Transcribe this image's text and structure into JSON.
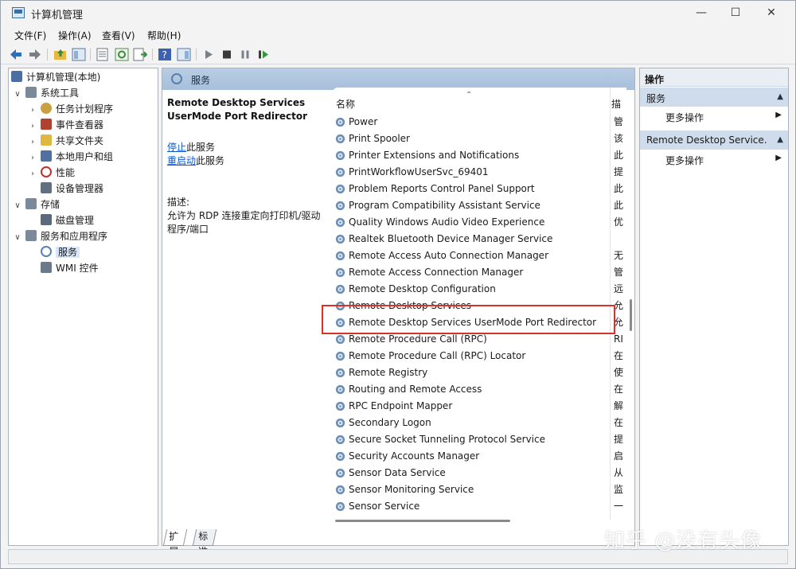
{
  "window": {
    "title": "计算机管理"
  },
  "window_controls": {
    "minimize": "—",
    "maximize": "☐",
    "close": "✕"
  },
  "menu": [
    "文件(F)",
    "操作(A)",
    "查看(V)",
    "帮助(H)"
  ],
  "tree": {
    "items": [
      {
        "label": "计算机管理(本地)",
        "expander": "",
        "icon_color": "#4a6fa5"
      },
      {
        "label": "系统工具",
        "expander": "∨",
        "icon_color": "#7a8a9a"
      },
      {
        "label": "任务计划程序",
        "expander": "›",
        "icon_color": "#c8a040"
      },
      {
        "label": "事件查看器",
        "expander": "›",
        "icon_color": "#b04030"
      },
      {
        "label": "共享文件夹",
        "expander": "›",
        "icon_color": "#e0b840"
      },
      {
        "label": "本地用户和组",
        "expander": "›",
        "icon_color": "#5070a0"
      },
      {
        "label": "性能",
        "expander": "›",
        "icon_color": "#c03030"
      },
      {
        "label": "设备管理器",
        "expander": "",
        "icon_color": "#607080"
      },
      {
        "label": "存储",
        "expander": "∨",
        "icon_color": "#7a8a9a"
      },
      {
        "label": "磁盘管理",
        "expander": "",
        "icon_color": "#5a6a7a"
      },
      {
        "label": "服务和应用程序",
        "expander": "∨",
        "icon_color": "#7a8a9a"
      },
      {
        "label": "服务",
        "expander": "",
        "icon_color": "#5a82b0"
      },
      {
        "label": "WMI 控件",
        "expander": "",
        "icon_color": "#6a7a8a"
      }
    ]
  },
  "middle": {
    "header": "服务",
    "selected_service": "Remote Desktop Services UserMode Port Redirector",
    "links": {
      "stop_link": "停止",
      "stop_rest": "此服务",
      "restart_link": "重启动",
      "restart_rest": "此服务"
    },
    "desc_label": "描述:",
    "description": "允许为 RDP 连接重定向打印机/驱动程序/端口",
    "columns": {
      "name": "名称",
      "desc": "描"
    },
    "rows": [
      {
        "name": "Power",
        "desc": "管"
      },
      {
        "name": "Print Spooler",
        "desc": "该"
      },
      {
        "name": "Printer Extensions and Notifications",
        "desc": "此"
      },
      {
        "name": "PrintWorkflowUserSvc_69401",
        "desc": "提"
      },
      {
        "name": "Problem Reports Control Panel Support",
        "desc": "此"
      },
      {
        "name": "Program Compatibility Assistant Service",
        "desc": "此"
      },
      {
        "name": "Quality Windows Audio Video Experience",
        "desc": "优"
      },
      {
        "name": "Realtek Bluetooth Device Manager Service",
        "desc": ""
      },
      {
        "name": "Remote Access Auto Connection Manager",
        "desc": "无"
      },
      {
        "name": "Remote Access Connection Manager",
        "desc": "管"
      },
      {
        "name": "Remote Desktop Configuration",
        "desc": "远"
      },
      {
        "name": "Remote Desktop Services",
        "desc": "允"
      },
      {
        "name": "Remote Desktop Services UserMode Port Redirector",
        "desc": "允"
      },
      {
        "name": "Remote Procedure Call (RPC)",
        "desc": "RI"
      },
      {
        "name": "Remote Procedure Call (RPC) Locator",
        "desc": "在"
      },
      {
        "name": "Remote Registry",
        "desc": "使"
      },
      {
        "name": "Routing and Remote Access",
        "desc": "在"
      },
      {
        "name": "RPC Endpoint Mapper",
        "desc": "解"
      },
      {
        "name": "Secondary Logon",
        "desc": "在"
      },
      {
        "name": "Secure Socket Tunneling Protocol Service",
        "desc": "提"
      },
      {
        "name": "Security Accounts Manager",
        "desc": "启"
      },
      {
        "name": "Sensor Data Service",
        "desc": "从"
      },
      {
        "name": "Sensor Monitoring Service",
        "desc": "监"
      },
      {
        "name": "Sensor Service",
        "desc": "一"
      }
    ],
    "tabs": [
      "扩展",
      "标准"
    ]
  },
  "actions": {
    "title": "操作",
    "groups": [
      {
        "label": "服务",
        "item": "更多操作"
      },
      {
        "label": "Remote Desktop Service...",
        "item": "更多操作"
      }
    ]
  },
  "watermark": "知乎 @没有头像",
  "colors": {
    "accent": "#0b57d0",
    "highlight_box": "#d9322a",
    "pane_header": "#b9cde4"
  }
}
